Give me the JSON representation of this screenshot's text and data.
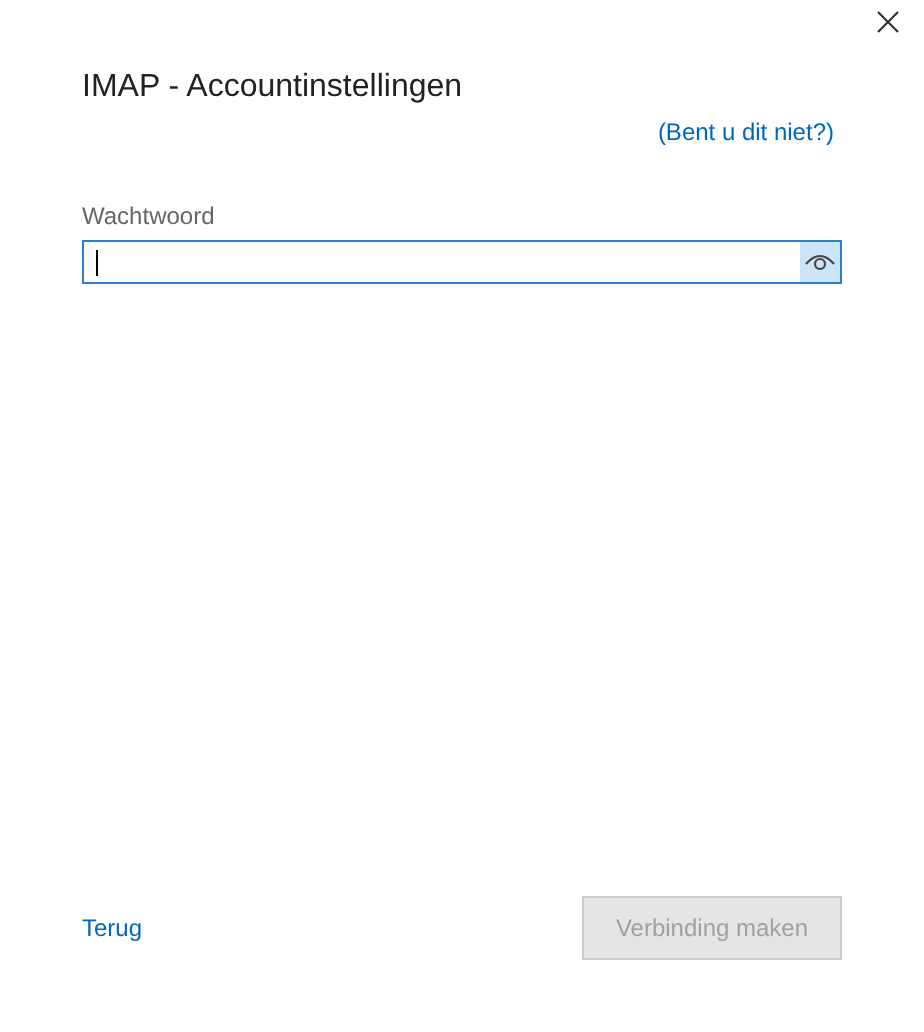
{
  "window": {
    "title": "IMAP - Accountinstellingen"
  },
  "not_you_link": "(Bent u dit niet?)",
  "password": {
    "label": "Wachtwoord",
    "focused": true
  },
  "back_link": "Terug",
  "connect_button": {
    "label": "Verbinding maken",
    "disabled": true
  }
}
